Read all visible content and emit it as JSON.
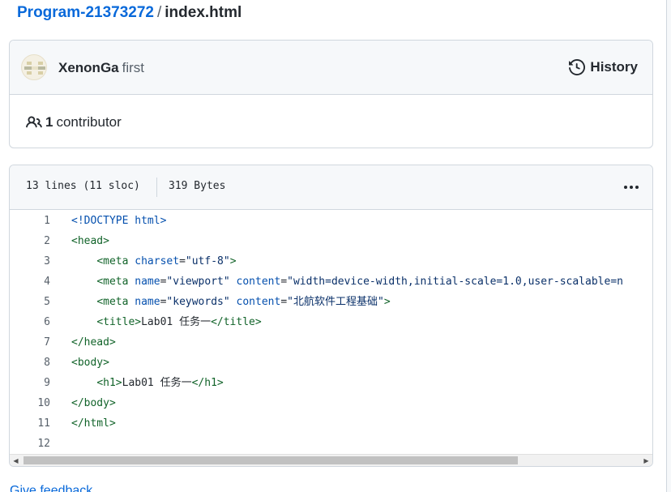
{
  "breadcrumb": {
    "repo": "Program-21373272",
    "separator": "/",
    "file": "index.html"
  },
  "commit": {
    "author": "XenonGa",
    "message": "first",
    "history_label": "History"
  },
  "contributors": {
    "count": "1",
    "label": "contributor"
  },
  "file_info": {
    "lines": "13 lines (11 sloc)",
    "size": "319 Bytes"
  },
  "code_lines": [
    {
      "n": "1",
      "tokens": [
        [
          "doc",
          "<!DOCTYPE html>"
        ]
      ]
    },
    {
      "n": "2",
      "tokens": [
        [
          "tg",
          "<head>"
        ]
      ]
    },
    {
      "n": "3",
      "tokens": [
        [
          "tx",
          "    "
        ],
        [
          "tg",
          "<meta"
        ],
        [
          "tx",
          " "
        ],
        [
          "at",
          "charset"
        ],
        [
          "tx",
          "="
        ],
        [
          "st",
          "\"utf-8\""
        ],
        [
          "tg",
          ">"
        ]
      ]
    },
    {
      "n": "4",
      "tokens": [
        [
          "tx",
          "    "
        ],
        [
          "tg",
          "<meta"
        ],
        [
          "tx",
          " "
        ],
        [
          "at",
          "name"
        ],
        [
          "tx",
          "="
        ],
        [
          "st",
          "\"viewport\""
        ],
        [
          "tx",
          " "
        ],
        [
          "at",
          "content"
        ],
        [
          "tx",
          "="
        ],
        [
          "st",
          "\"width=device-width,initial-scale=1.0,user-scalable=n"
        ]
      ]
    },
    {
      "n": "5",
      "tokens": [
        [
          "tx",
          "    "
        ],
        [
          "tg",
          "<meta"
        ],
        [
          "tx",
          " "
        ],
        [
          "at",
          "name"
        ],
        [
          "tx",
          "="
        ],
        [
          "st",
          "\"keywords\""
        ],
        [
          "tx",
          " "
        ],
        [
          "at",
          "content"
        ],
        [
          "tx",
          "="
        ],
        [
          "st",
          "\"北航软件工程基础\""
        ],
        [
          "tg",
          ">"
        ]
      ]
    },
    {
      "n": "6",
      "tokens": [
        [
          "tx",
          "    "
        ],
        [
          "tg",
          "<title>"
        ],
        [
          "tx",
          "Lab01 任务一"
        ],
        [
          "tg",
          "</title>"
        ]
      ]
    },
    {
      "n": "7",
      "tokens": [
        [
          "tg",
          "</head>"
        ]
      ]
    },
    {
      "n": "8",
      "tokens": [
        [
          "tg",
          "<body>"
        ]
      ]
    },
    {
      "n": "9",
      "tokens": [
        [
          "tx",
          "    "
        ],
        [
          "tg",
          "<h1>"
        ],
        [
          "tx",
          "Lab01 任务一"
        ],
        [
          "tg",
          "</h1>"
        ]
      ]
    },
    {
      "n": "10",
      "tokens": [
        [
          "tg",
          "</body>"
        ]
      ]
    },
    {
      "n": "11",
      "tokens": [
        [
          "tg",
          "</html>"
        ]
      ]
    },
    {
      "n": "12",
      "tokens": []
    }
  ],
  "scrollbar": {
    "left_arrow": "◀",
    "right_arrow": "▶"
  },
  "feedback": {
    "label": "Give feedback"
  },
  "icons": {
    "history": "history-icon",
    "people": "people-icon",
    "kebab": "kebab-horizontal-icon"
  },
  "colors": {
    "link": "#0969da",
    "tag": "#116329",
    "attr": "#0550ae",
    "string": "#0a3069"
  }
}
